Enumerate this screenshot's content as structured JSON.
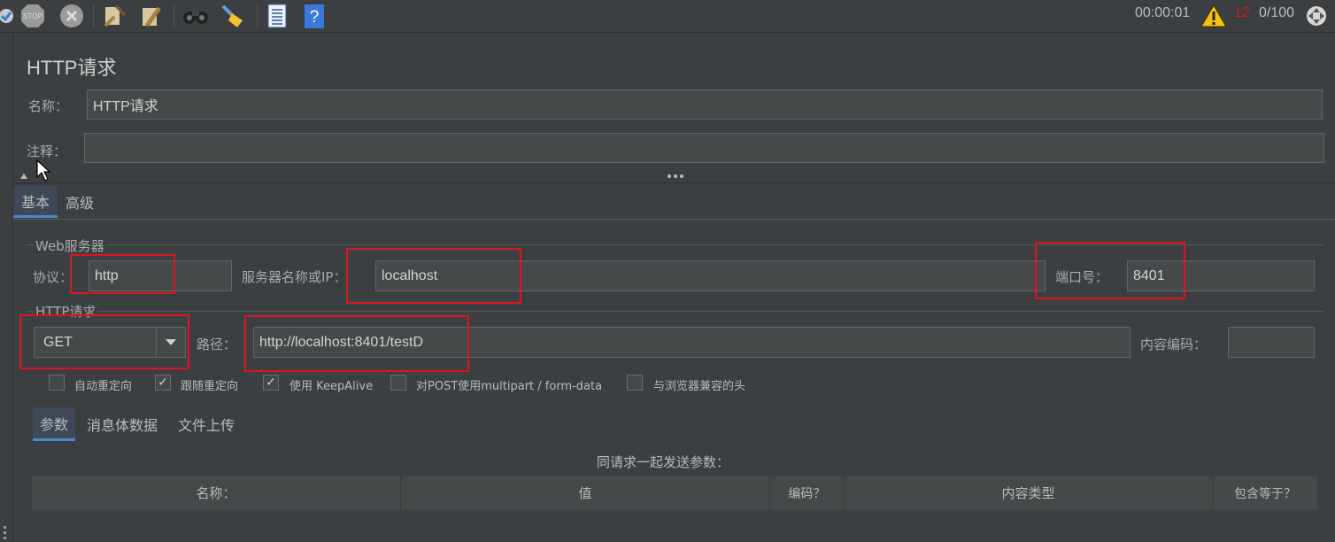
{
  "toolbar": {
    "icons": [
      "clear-icon",
      "stop-icon",
      "shutdown-icon",
      "clear-all-icon",
      "clear-broom-icon",
      "search-binoculars-icon",
      "reset-broom-icon",
      "function-list-icon",
      "help-icon"
    ],
    "stop_text": "STOP",
    "help_text": "?",
    "elapsed": "00:00:01",
    "error_count": "12",
    "threads": "0/100"
  },
  "header": {
    "title": "HTTP请求",
    "name_label": "名称：",
    "name_value": "HTTP请求",
    "comment_label": "注释：",
    "comment_value": ""
  },
  "tabs": [
    "基本",
    "高级"
  ],
  "web_server": {
    "legend": "Web服务器",
    "protocol_label": "协议：",
    "protocol_value": "http",
    "server_label": "服务器名称或IP：",
    "server_value": "localhost",
    "port_label": "端口号：",
    "port_value": "8401"
  },
  "http_request": {
    "legend": "HTTP请求",
    "method": "GET",
    "path_label": "路径：",
    "path_value": "http://localhost:8401/testD",
    "encoding_label": "内容编码：",
    "encoding_value": ""
  },
  "options": [
    {
      "label": "自动重定向",
      "checked": false
    },
    {
      "label": "跟随重定向",
      "checked": true
    },
    {
      "label": "使用 KeepAlive",
      "checked": true
    },
    {
      "label": "对POST使用multipart / form-data",
      "checked": false
    },
    {
      "label": "与浏览器兼容的头",
      "checked": false
    }
  ],
  "subtabs": [
    "参数",
    "消息体数据",
    "文件上传"
  ],
  "params": {
    "caption": "同请求一起发送参数：",
    "columns": [
      "名称：",
      "值",
      "编码？",
      "内容类型",
      "包含等于？"
    ]
  },
  "colors": {
    "background": "#3c3f41",
    "field": "#45494a",
    "highlight": "#e0141e",
    "warning": "#f5c211",
    "error_count": "#e0141e",
    "tab_underline": "#4a88c7"
  }
}
